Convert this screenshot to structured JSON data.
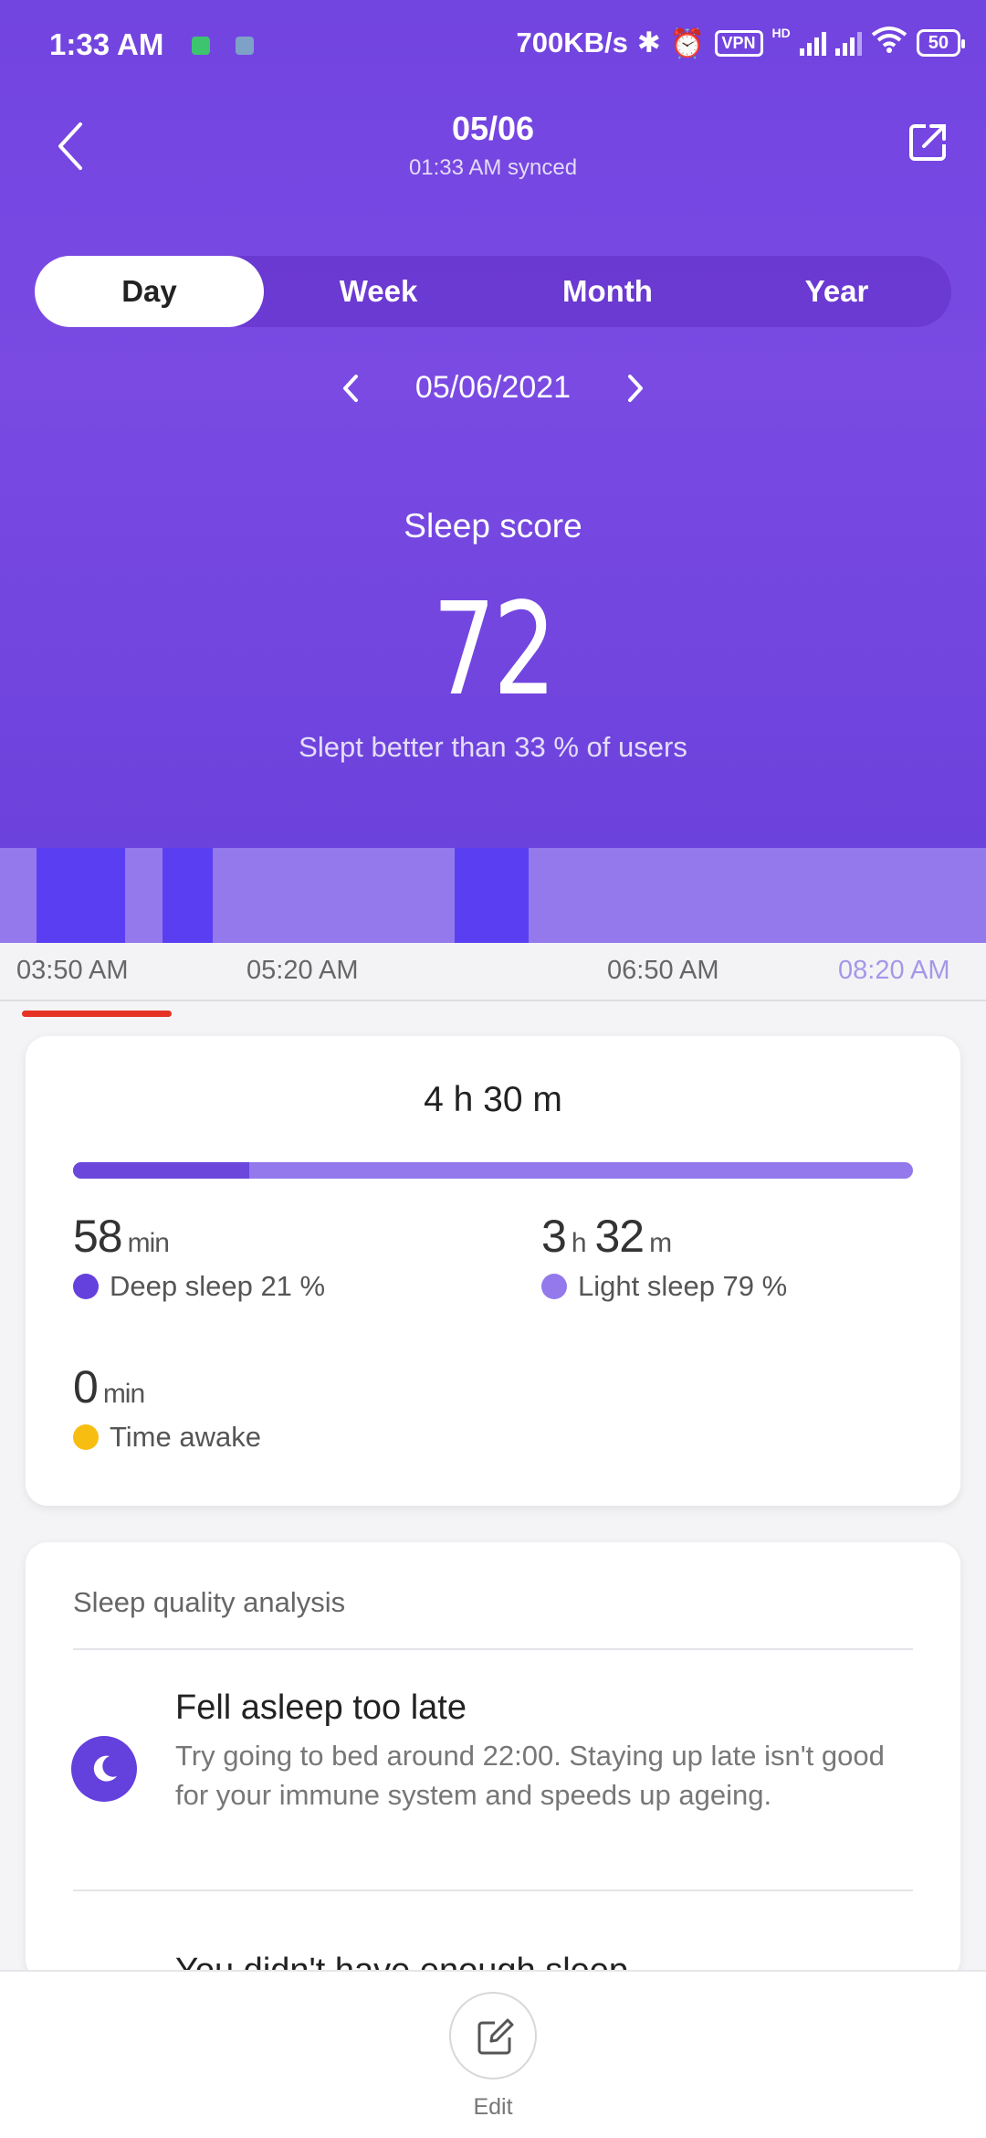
{
  "status_bar": {
    "time": "1:33 AM",
    "speed": "700KB/s",
    "vpn": "VPN",
    "hd": "HD",
    "battery": "50"
  },
  "header": {
    "title": "05/06",
    "subtitle": "01:33 AM synced"
  },
  "tabs": [
    "Day",
    "Week",
    "Month",
    "Year"
  ],
  "active_tab": "Day",
  "date_nav": {
    "date": "05/06/2021"
  },
  "score": {
    "label": "Sleep score",
    "value": "72",
    "subtext": "Slept better than 33 % of users"
  },
  "timeline": {
    "axis_labels": [
      "03:50 AM",
      "05:20 AM",
      "06:50 AM",
      "08:20 AM"
    ],
    "deep_segments_fraction": [
      [
        0.037,
        0.127
      ],
      [
        0.165,
        0.216
      ],
      [
        0.461,
        0.536
      ]
    ]
  },
  "summary": {
    "total": "4 h 30 m",
    "deep_fraction": 0.21,
    "deep": {
      "value": "58",
      "unit": "min",
      "label": "Deep sleep 21 %",
      "color": "#6440dc"
    },
    "light": {
      "hours": "3",
      "h_unit": "h",
      "minutes": "32",
      "m_unit": "m",
      "label": "Light sleep 79 %",
      "color": "#9379ec"
    },
    "awake": {
      "value": "0",
      "unit": "min",
      "label": "Time awake",
      "color": "#f7bd10"
    }
  },
  "analysis": {
    "title": "Sleep quality analysis",
    "items": [
      {
        "title": "Fell asleep too late",
        "description": "Try going to bed around 22:00. Staying up late isn't good for your immune system and speeds up ageing.",
        "icon": "moon-icon"
      },
      {
        "title": "You didn't have enough sleep"
      }
    ]
  },
  "bottom": {
    "edit_label": "Edit"
  },
  "colors": {
    "accent": "#7244e0",
    "deep": "#5a3ff2",
    "light": "#9379ec",
    "marker": "#e53222"
  }
}
